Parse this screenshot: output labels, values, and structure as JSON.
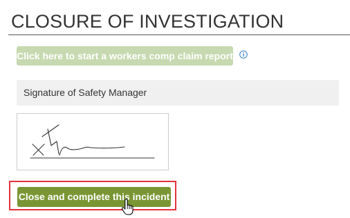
{
  "section": {
    "title": "CLOSURE OF INVESTIGATION"
  },
  "workers_comp": {
    "button_label": "Click here to start a workers comp claim report",
    "info_icon": "info-circle-icon"
  },
  "signature": {
    "label": "Signature of Safety Manager"
  },
  "actions": {
    "close_button_label": "Close and complete this incident"
  },
  "cursor": {
    "icon": "hand-pointer-icon"
  },
  "colors": {
    "claim_button_bg": "#c7d9b0",
    "close_button_bg": "#7a9634",
    "highlight_border": "#e3323d",
    "info_icon": "#3a7fc1"
  }
}
